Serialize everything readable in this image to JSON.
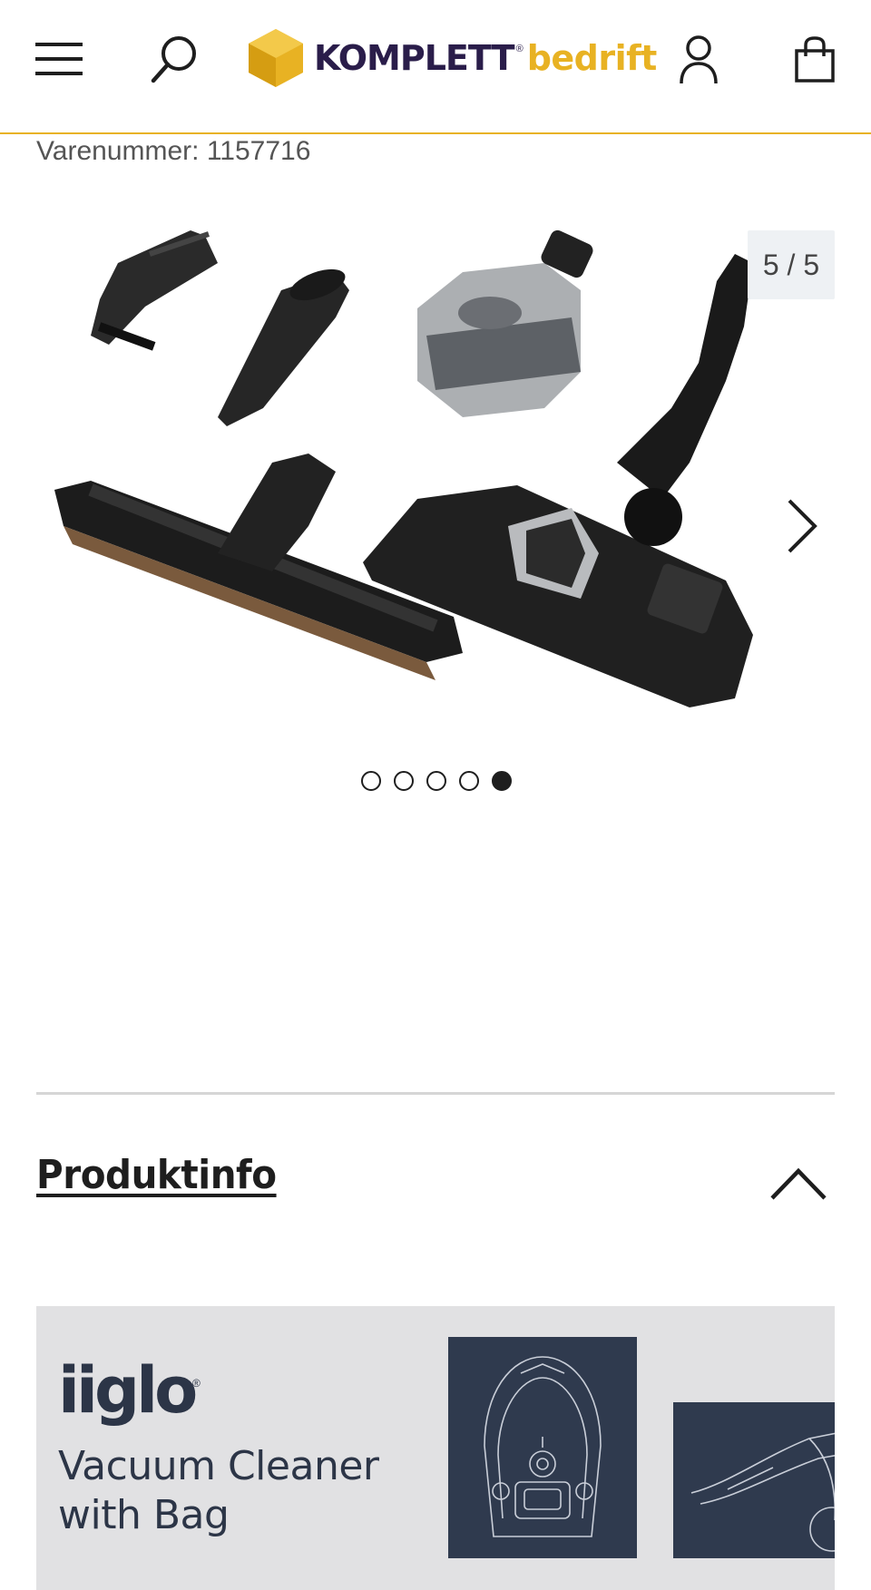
{
  "header": {
    "logo_text_primary": "KOMPLETT",
    "logo_registered": "®",
    "logo_text_secondary": "bedrift",
    "brand_colors": {
      "primary": "#2a1d4a",
      "accent": "#e8b223"
    },
    "icons": [
      "menu-icon",
      "search-icon",
      "account-icon",
      "cart-icon"
    ]
  },
  "product": {
    "sku_text": "Varenummer: 1157716"
  },
  "gallery": {
    "counter": "5 / 5",
    "image_count": 5,
    "active_index": 5,
    "image_alt": "Vacuum cleaner nozzles and brushes accessory set"
  },
  "produktinfo": {
    "title": "Produktinfo",
    "expanded": true
  },
  "banner": {
    "brand": "iiglo",
    "brand_registered": "®",
    "subtitle_line1": "Vacuum Cleaner",
    "subtitle_line2": "with Bag",
    "colors": {
      "background": "#e1e1e3",
      "panel": "#2f3a4e"
    }
  }
}
